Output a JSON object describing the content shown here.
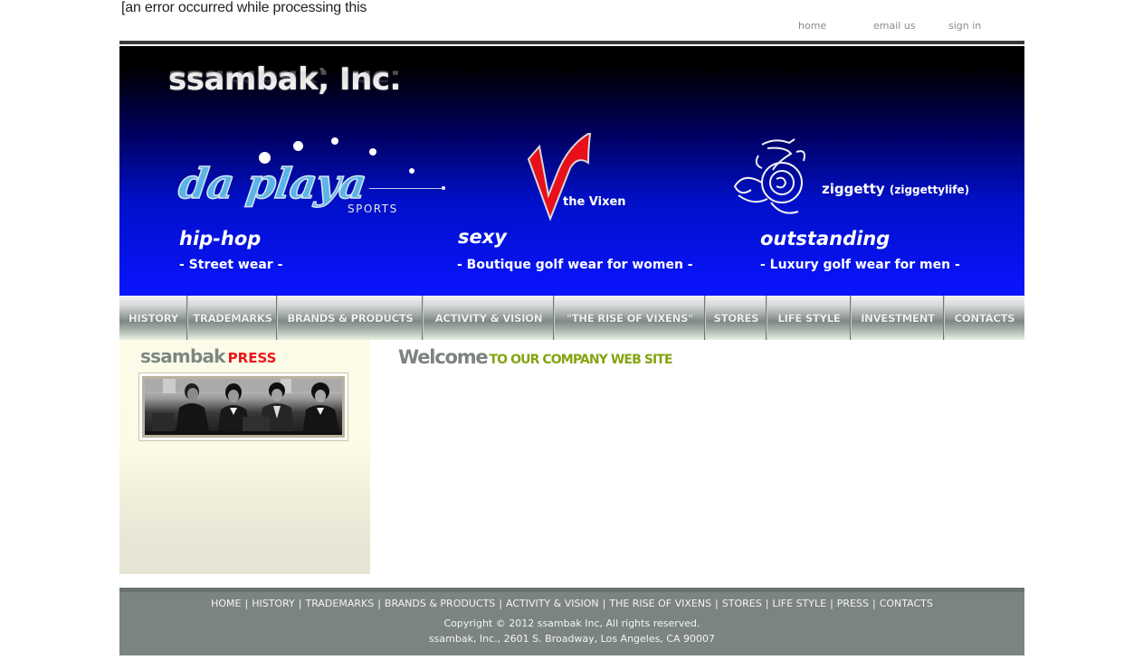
{
  "error_message": "[an error occurred while processing this",
  "top_links": {
    "home": "home",
    "email": "email us",
    "signin": "sign in"
  },
  "banner": {
    "company_name": "ssambak, Inc.",
    "brands": [
      {
        "name": "da playa",
        "subtitle": "SPORTS",
        "tagline": "hip-hop",
        "description": "- Street wear -"
      },
      {
        "name": "the Vixen",
        "tagline": "sexy",
        "description": "- Boutique golf wear for women -"
      },
      {
        "name": "ziggetty",
        "name_sub": "(ziggettylife)",
        "tagline": "outstanding",
        "description": "- Luxury golf wear for men -"
      }
    ]
  },
  "nav": {
    "items": [
      "HISTORY",
      "TRADEMARKS",
      "BRANDS & PRODUCTS",
      "ACTIVITY & VISION",
      "\"THE RISE OF VIXENS\"",
      "STORES",
      "LIFE STYLE",
      "INVESTMENT",
      "CONTACTS"
    ]
  },
  "sidebar": {
    "press_title_1": "ssambak",
    "press_title_2": "PRESS"
  },
  "main": {
    "welcome_big": "Welcome",
    "welcome_small": "TO OUR COMPANY WEB SITE"
  },
  "footer": {
    "links": [
      "HOME",
      "HISTORY",
      "TRADEMARKS",
      "BRANDS & PRODUCTS",
      "ACTIVITY & VISION",
      "THE RISE OF VIXENS",
      "STORES",
      "LIFE STYLE",
      "PRESS",
      "CONTACTS"
    ],
    "separator": "|",
    "copyright": "Copyright © 2012 ssambak Inc, All rights reserved.",
    "address": "ssambak, Inc., 2601 S. Broadway, Los Angeles, CA 90007"
  },
  "colors": {
    "banner_blue": "#0a14ff",
    "press_red": "#e8161a",
    "welcome_green": "#84a412",
    "footer_gray": "#7c8482"
  }
}
